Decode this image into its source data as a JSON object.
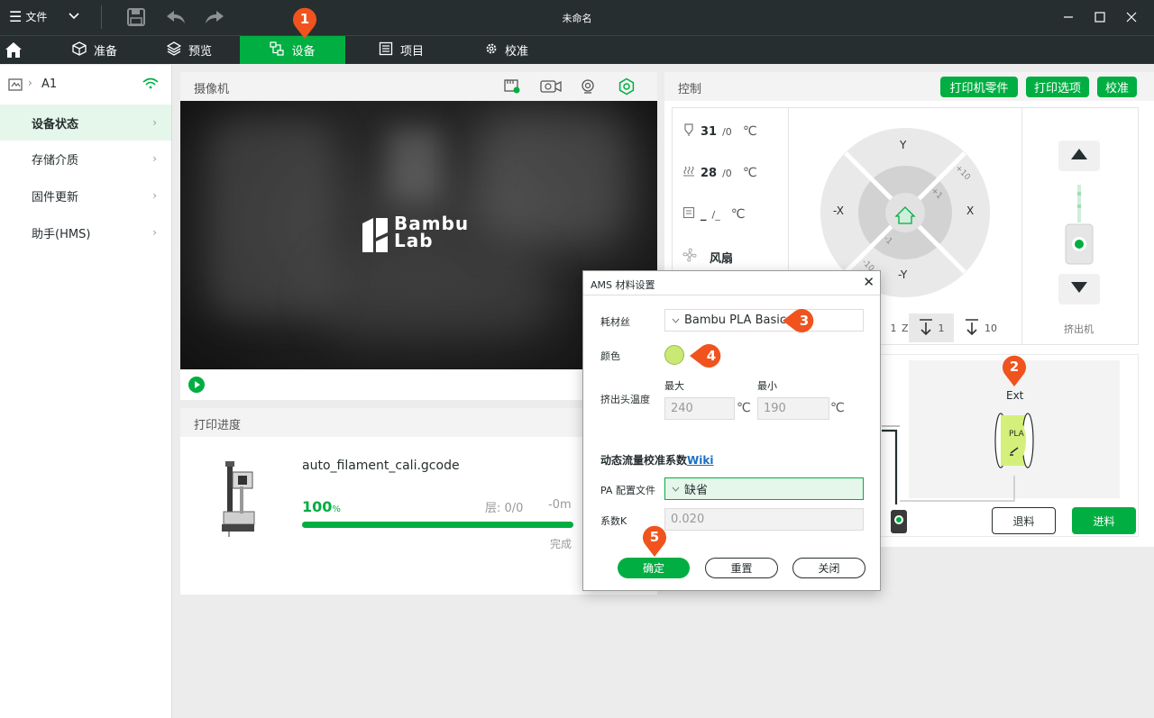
{
  "titlebar": {
    "file_menu": "文件",
    "window_title": "未命名"
  },
  "nav": {
    "tabs": [
      {
        "label": "准备"
      },
      {
        "label": "预览"
      },
      {
        "label": "设备"
      },
      {
        "label": "项目"
      },
      {
        "label": "校准"
      }
    ]
  },
  "sidebar": {
    "device_name": "A1",
    "items": [
      {
        "label": "设备状态"
      },
      {
        "label": "存储介质"
      },
      {
        "label": "固件更新"
      },
      {
        "label": "助手(HMS)"
      }
    ]
  },
  "camera": {
    "title": "摄像机",
    "logo_line1": "Bambu",
    "logo_line2": "Lab"
  },
  "progress": {
    "title": "打印进度",
    "file_name": "auto_filament_cali.gcode",
    "percent": "100",
    "percent_unit": "%",
    "progress_fraction": 1.0,
    "layer": "层:  0/0",
    "time_remaining": "-0m",
    "status": "完成"
  },
  "control": {
    "title": "控制",
    "buttons": {
      "parts": "打印机零件",
      "options": "打印选项",
      "calibrate": "校准"
    },
    "temps": [
      {
        "value": "31",
        "target": "/0",
        "unit": "℃"
      },
      {
        "value": "28",
        "target": "/0",
        "unit": "℃"
      },
      {
        "value": "_",
        "target": "/_",
        "unit": "℃"
      }
    ],
    "fan_label": "风扇",
    "jog": {
      "y": "Y",
      "neg_y": "-Y",
      "x": "X",
      "neg_x": "-X",
      "p10": "+10",
      "p1": "+1",
      "m1": "-1",
      "m10": "-10"
    },
    "z_steps": {
      "s1": "1",
      "z": "Z",
      "d1": "1",
      "d10": "10"
    },
    "extruder_label": "挤出机",
    "ext_label": "Ext",
    "spool_label": "PLA",
    "unload": "退料",
    "load": "进料"
  },
  "dialog": {
    "title": "AMS 材料设置",
    "filament_label": "耗材丝",
    "filament_value": "Bambu PLA Basic",
    "color_label": "颜色",
    "color_value": "#c9e874",
    "nozzle_temp_label": "挤出头温度",
    "max_label": "最大",
    "min_label": "最小",
    "max_value": "240",
    "min_value": "190",
    "temp_unit": "℃",
    "flow_title": "动态流量校准系数",
    "wiki_link": "Wiki",
    "pa_label": "PA 配置文件",
    "pa_value": "缺省",
    "k_label": "系数K",
    "k_value": "0.020",
    "confirm": "确定",
    "reset": "重置",
    "close": "关闭"
  },
  "markers": [
    "1",
    "2",
    "3",
    "4",
    "5"
  ],
  "colors": {
    "accent": "#00ae42",
    "dark": "#262e30",
    "marker": "#f0531e"
  }
}
